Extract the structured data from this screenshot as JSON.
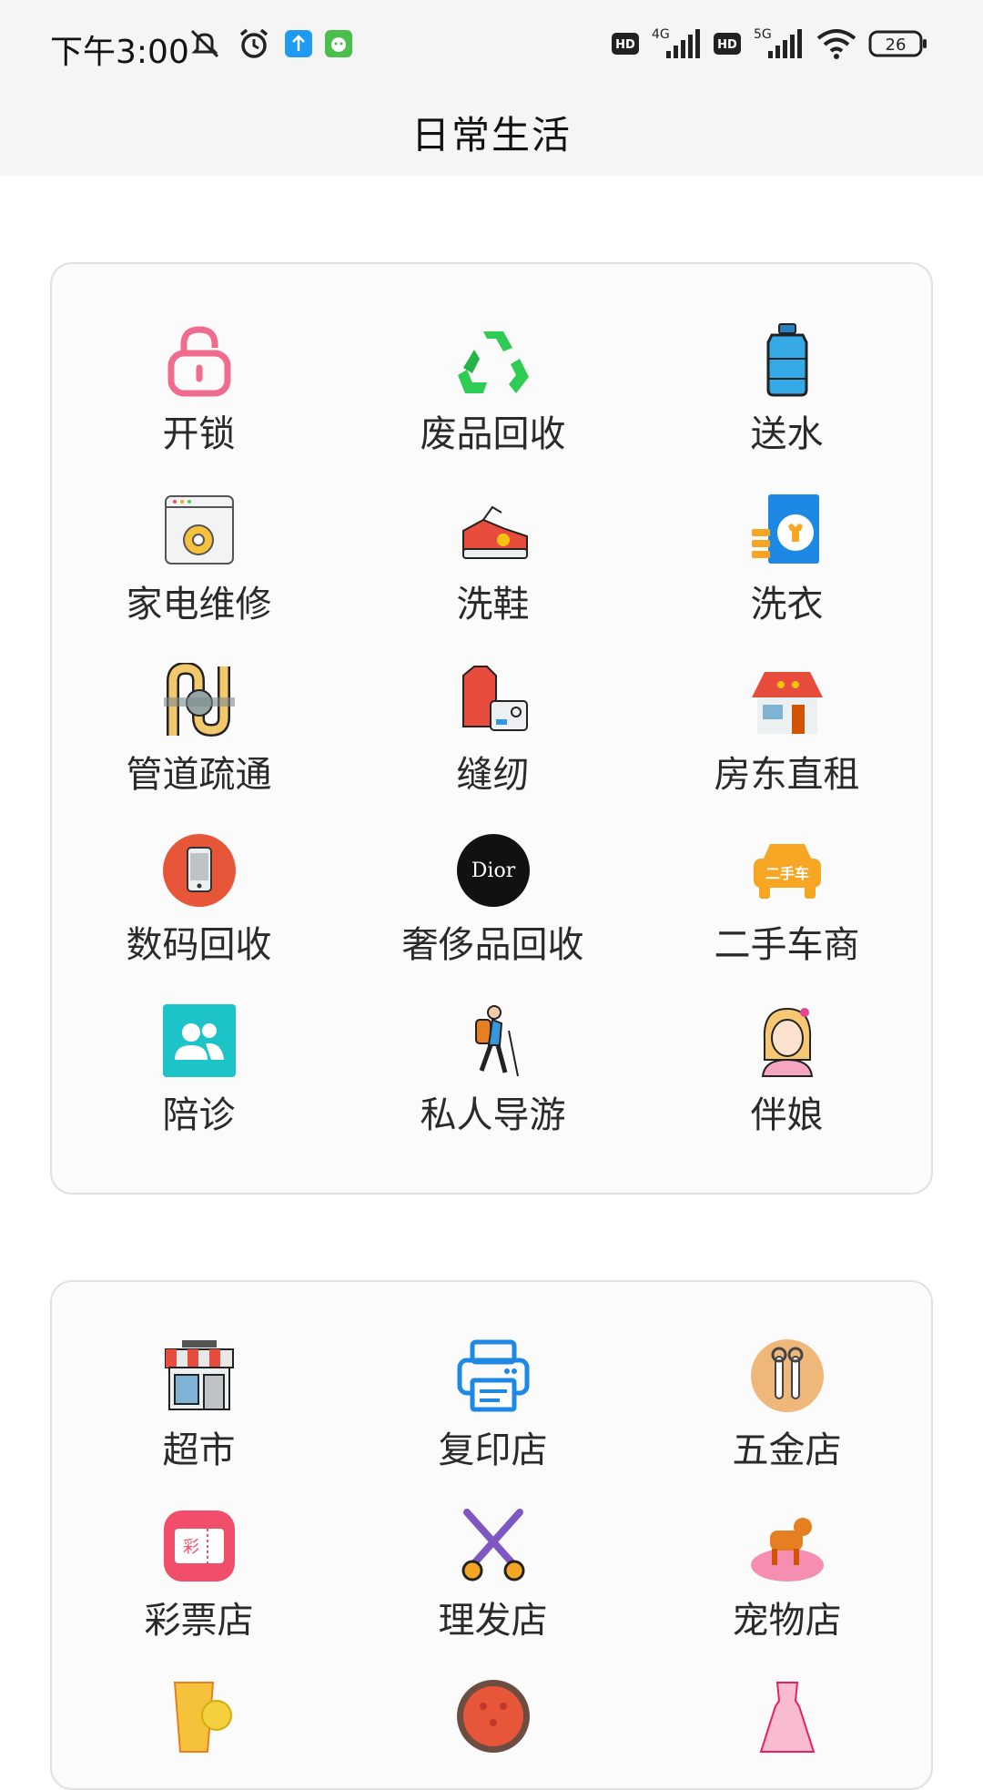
{
  "status": {
    "time": "下午3:00",
    "net1": "4G",
    "net2": "5G",
    "hd": "HD",
    "battery": "26",
    "icons_left": [
      "mute-icon",
      "alarm-icon",
      "upload-app-icon",
      "cat-app-icon"
    ],
    "icons_right": [
      "hd-icon",
      "signal-4g-icon",
      "hd-icon",
      "signal-5g-icon",
      "wifi-icon",
      "battery-icon"
    ]
  },
  "header": {
    "title": "日常生活"
  },
  "section1": {
    "items": [
      {
        "label": "开锁",
        "icon": "lock-icon"
      },
      {
        "label": "废品回收",
        "icon": "recycle-icon"
      },
      {
        "label": "送水",
        "icon": "water-bottle-icon"
      },
      {
        "label": "家电维修",
        "icon": "appliance-repair-icon"
      },
      {
        "label": "洗鞋",
        "icon": "sneaker-icon"
      },
      {
        "label": "洗衣",
        "icon": "laundry-icon"
      },
      {
        "label": "管道疏通",
        "icon": "pipe-icon"
      },
      {
        "label": "缝纫",
        "icon": "sewing-icon"
      },
      {
        "label": "房东直租",
        "icon": "house-icon"
      },
      {
        "label": "数码回收",
        "icon": "phone-recycle-icon"
      },
      {
        "label": "奢侈品回收",
        "icon": "dior-icon"
      },
      {
        "label": "二手车商",
        "icon": "used-car-icon"
      },
      {
        "label": "陪诊",
        "icon": "companion-icon"
      },
      {
        "label": "私人导游",
        "icon": "hiker-icon"
      },
      {
        "label": "伴娘",
        "icon": "bridesmaid-icon"
      }
    ]
  },
  "section2": {
    "items": [
      {
        "label": "超市",
        "icon": "store-icon"
      },
      {
        "label": "复印店",
        "icon": "printer-icon"
      },
      {
        "label": "五金店",
        "icon": "tools-icon"
      },
      {
        "label": "彩票店",
        "icon": "lottery-icon"
      },
      {
        "label": "理发店",
        "icon": "scissors-icon"
      },
      {
        "label": "宠物店",
        "icon": "pet-icon"
      },
      {
        "label": "",
        "icon": "juice-icon"
      },
      {
        "label": "",
        "icon": "pizza-icon"
      },
      {
        "label": "",
        "icon": "dress-icon"
      }
    ]
  },
  "icon_texts": {
    "dior": "Dior",
    "used_car": "二手车",
    "lottery": "彩"
  },
  "colors": {
    "lock": "#f06b8e",
    "recycle": "#2ecc52",
    "water": "#35a9e6",
    "accent_orange": "#f7a623",
    "dior_bg": "#111111",
    "teal": "#1cc4c8"
  }
}
